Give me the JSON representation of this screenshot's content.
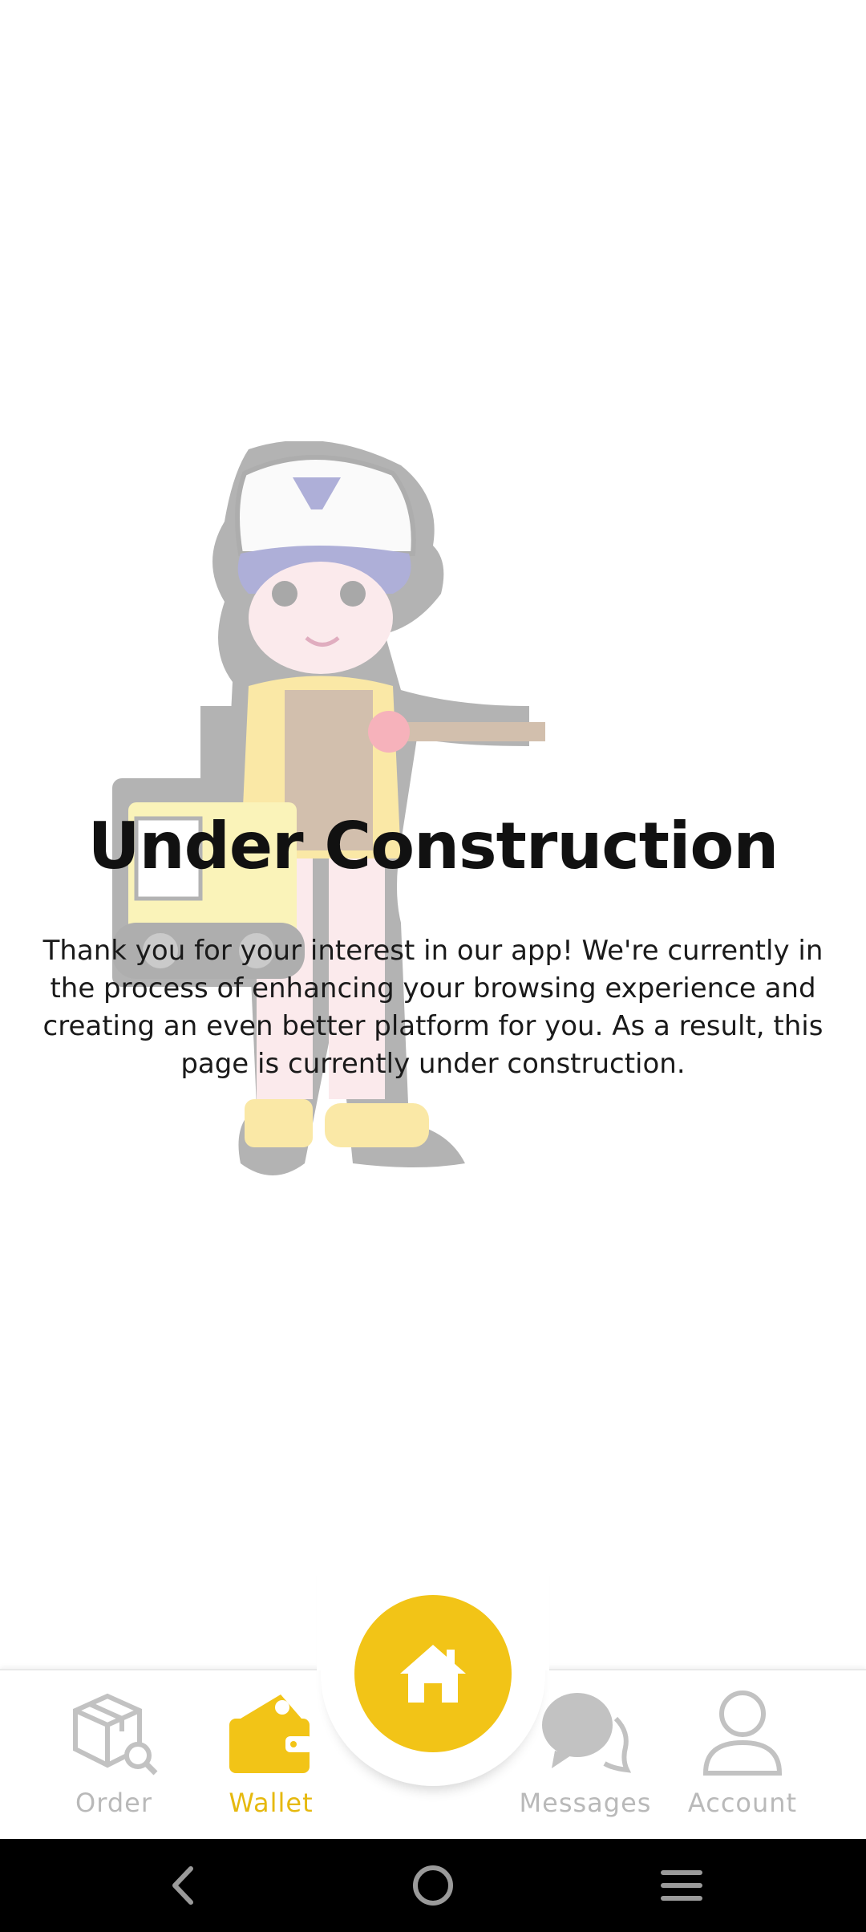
{
  "page": {
    "title": "Under Construction",
    "message": "Thank you for your interest in our app! We're currently in the process of enhancing your browsing experience and creating an even better platform for you. As a result, this page is currently under construction."
  },
  "bottom_nav": {
    "items": [
      {
        "label": "Order",
        "icon": "order-box-search-icon",
        "active": false
      },
      {
        "label": "Wallet",
        "icon": "wallet-icon",
        "active": true
      },
      {
        "label": "Messages",
        "icon": "chat-bubbles-icon",
        "active": false
      },
      {
        "label": "Account",
        "icon": "user-icon",
        "active": false
      }
    ],
    "home_icon": "home-icon"
  },
  "system_nav": {
    "buttons": [
      "back-icon",
      "home-circle-icon",
      "recents-menu-icon"
    ]
  },
  "colors": {
    "accent": "#f2c417",
    "active_label": "#e6b90f",
    "inactive": "#b9b9b9",
    "system_bar": "#000000"
  }
}
